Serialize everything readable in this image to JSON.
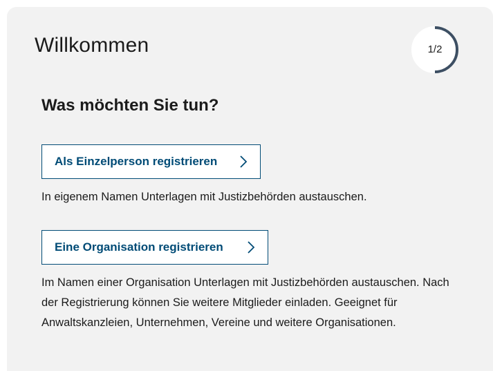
{
  "header": {
    "title": "Willkommen",
    "step_indicator": "1/2",
    "step_progress": 0.5
  },
  "main": {
    "question": "Was möchten Sie tun?",
    "options": [
      {
        "button_label": "Als Einzelperson registrieren",
        "description": "In eigenem Namen Unterlagen mit Justizbehörden austauschen."
      },
      {
        "button_label": "Eine Organisation registrieren",
        "description": "Im Namen einer Organisation Unterlagen mit Justizbehörden austauschen. Nach der Registrierung können Sie weitere Mitglieder einladen. Geeignet für Anwaltskanzleien, Unternehmen, Vereine und weitere Organisationen."
      }
    ]
  },
  "colors": {
    "card_background": "#f2f2f2",
    "accent": "#004b76",
    "progress_track": "#ffffff",
    "progress_fill": "#3d4f63"
  },
  "icons": [
    "chevron-right-icon"
  ]
}
